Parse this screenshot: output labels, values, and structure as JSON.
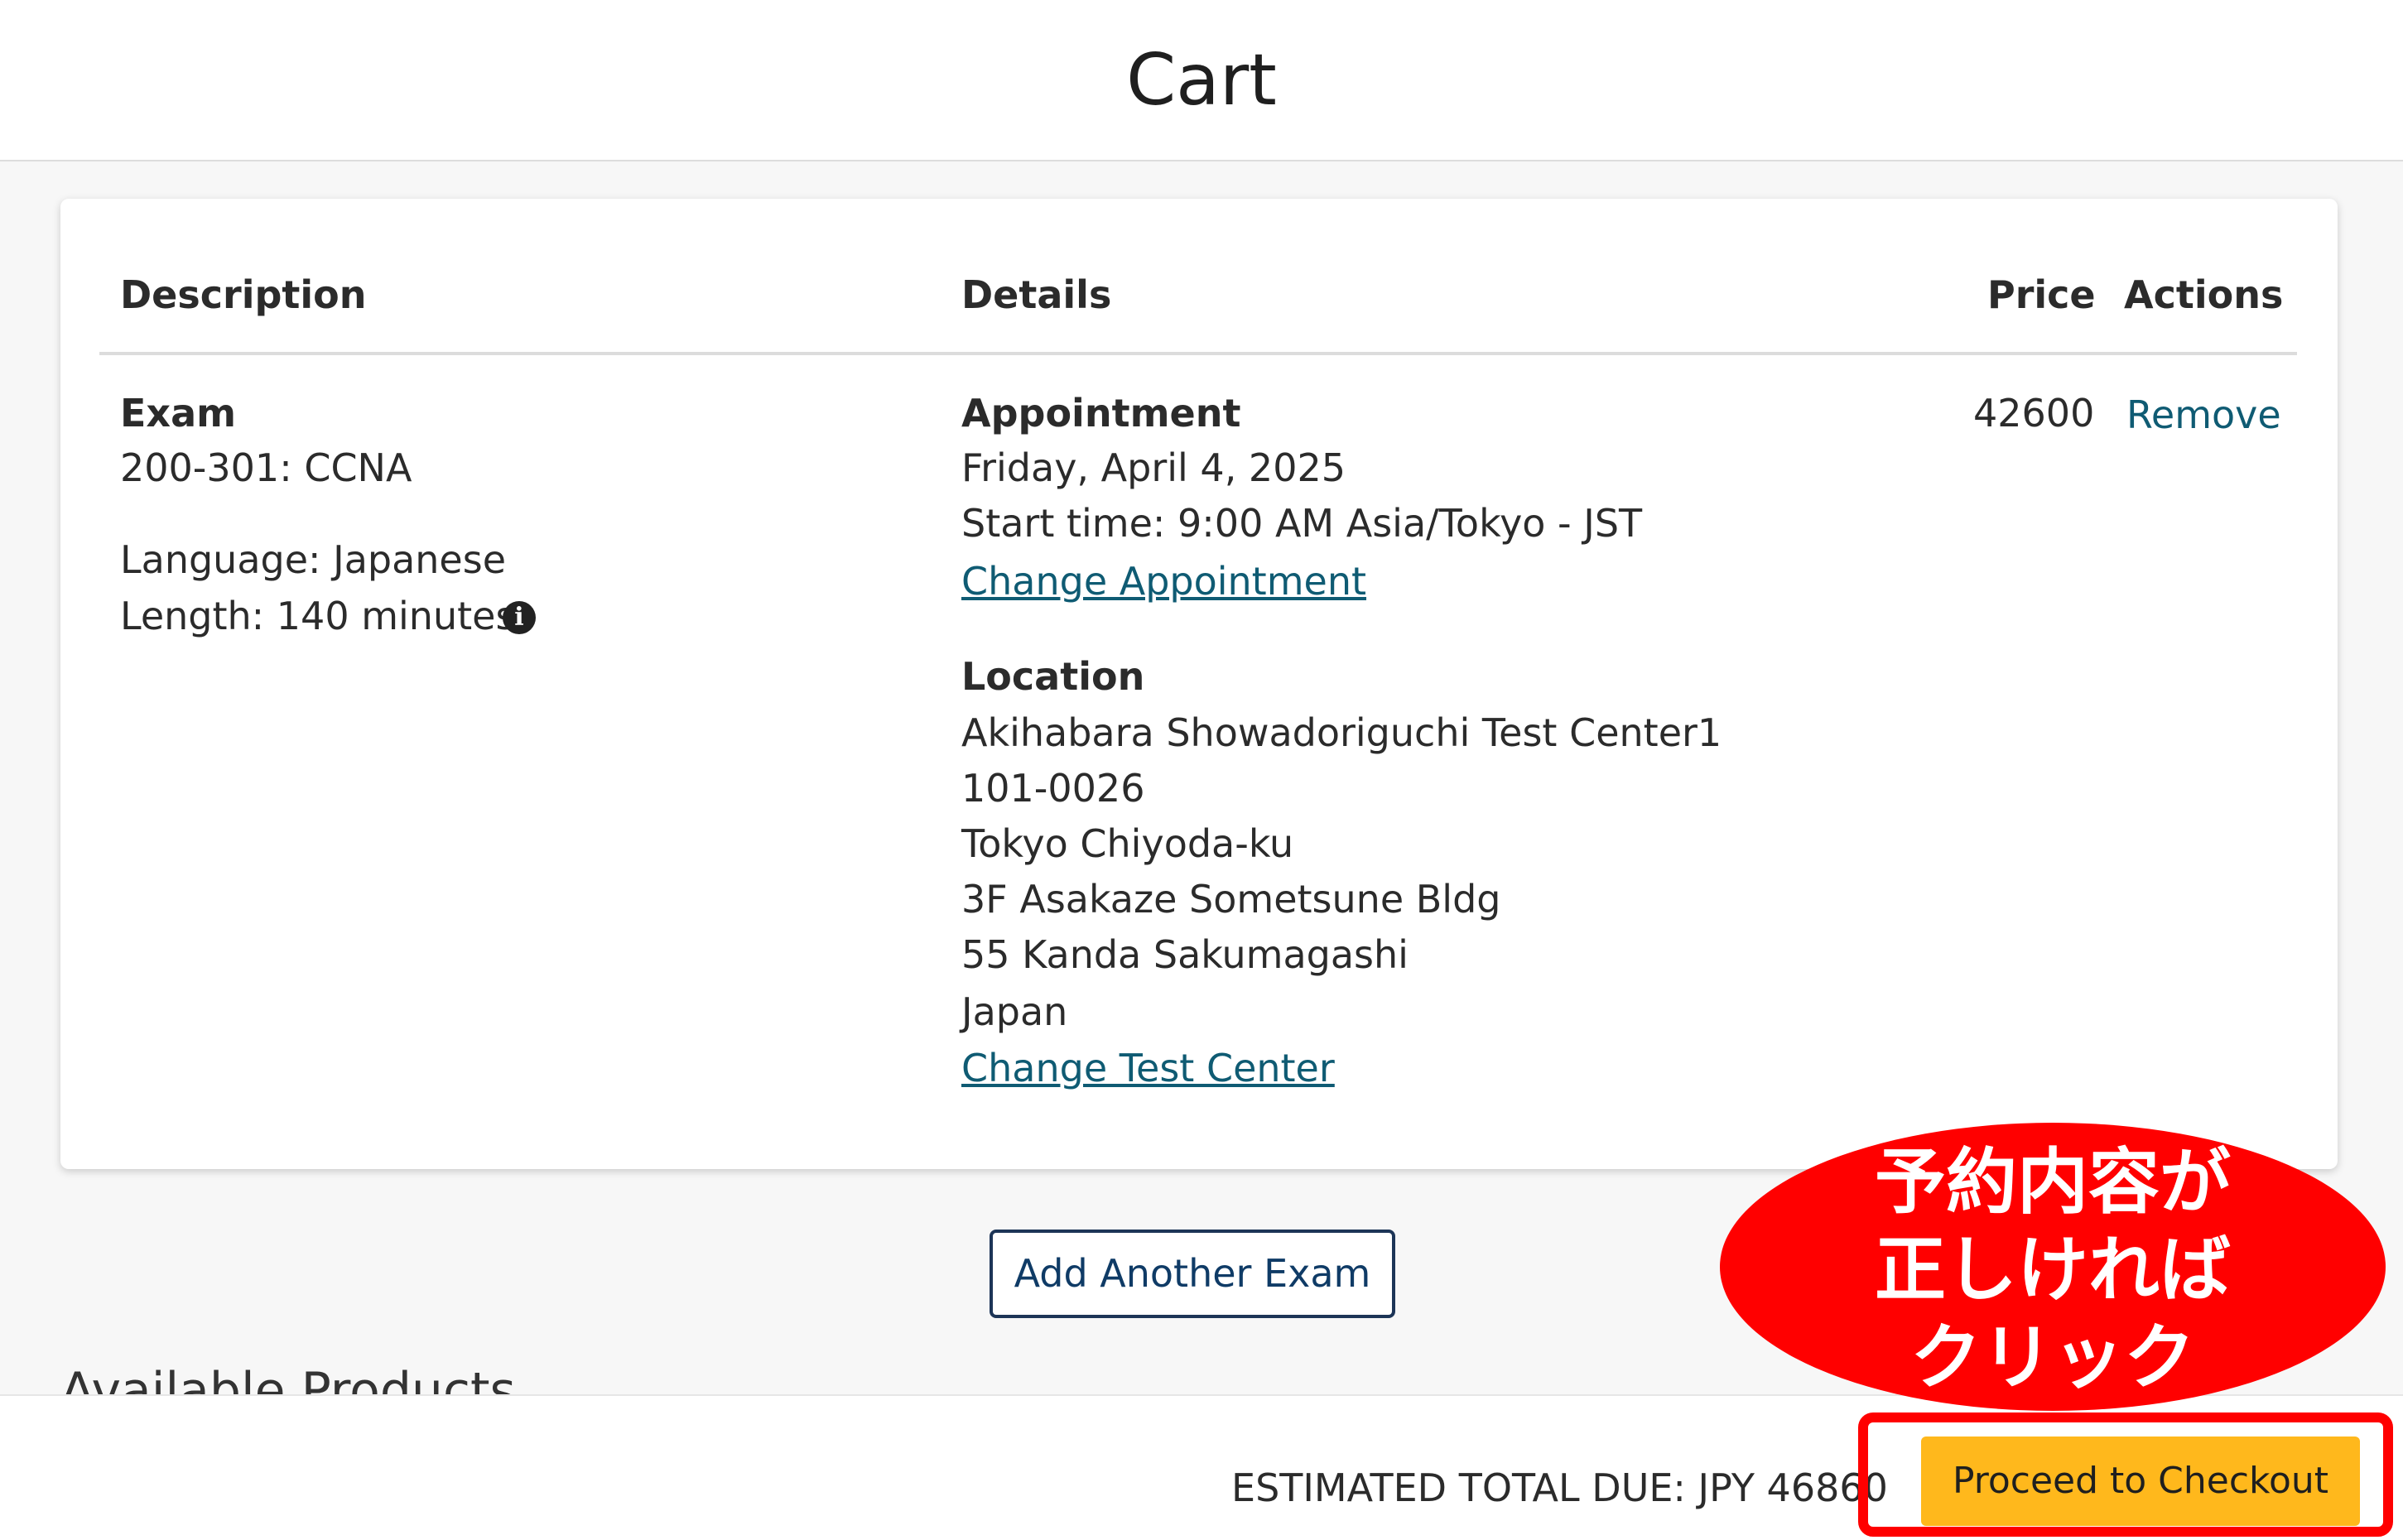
{
  "header": {
    "title": "Cart"
  },
  "table": {
    "columns": {
      "description": "Description",
      "details": "Details",
      "price": "Price",
      "actions": "Actions"
    },
    "row": {
      "description": {
        "type": "Exam",
        "exam_name": "200-301: CCNA",
        "language": "Language: Japanese",
        "length": "Length: 140 minutes",
        "info_icon": "info-circle-icon"
      },
      "appointment": {
        "heading": "Appointment",
        "date": "Friday, April 4, 2025",
        "start_time": "Start time: 9:00 AM Asia/Tokyo - JST",
        "change_link": "Change Appointment"
      },
      "location": {
        "heading": "Location",
        "lines": [
          "Akihabara Showadoriguchi Test Center1",
          "101-0026",
          "Tokyo Chiyoda-ku",
          "3F Asakaze Sometsune Bldg",
          "55 Kanda Sakumagashi",
          "Japan"
        ],
        "change_link": "Change Test Center"
      },
      "price": "42600",
      "remove_label": "Remove"
    }
  },
  "add_exam_label": "Add Another Exam",
  "partially_hidden_heading": "Available Products",
  "footer": {
    "total_label": "ESTIMATED TOTAL DUE: JPY 46860",
    "checkout_label": "Proceed to Checkout"
  },
  "annotation": {
    "lines": [
      "予約内容が",
      "正しければ",
      "クリック"
    ]
  },
  "colors": {
    "link": "#0f5b73",
    "checkout_button": "#ffb81c",
    "annotation_red": "#ff0000",
    "add_button_border": "#1d3557"
  }
}
